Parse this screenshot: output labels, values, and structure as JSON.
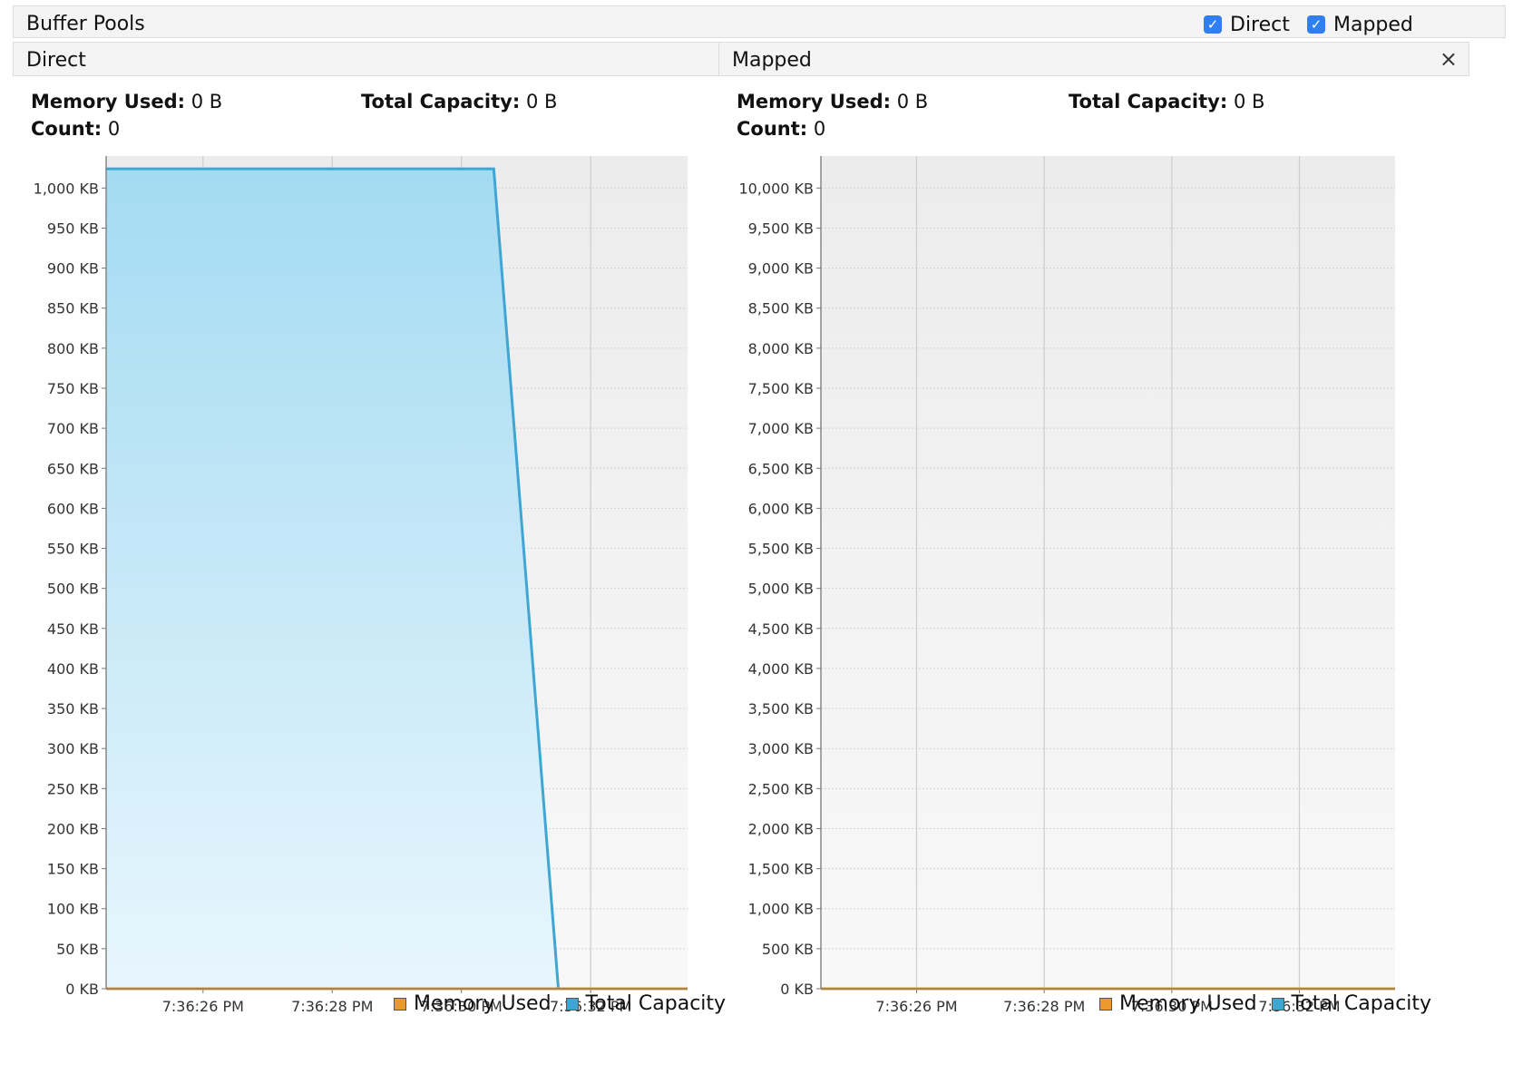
{
  "window": {
    "title": "Buffer Pools",
    "checkboxes": [
      {
        "label": "Direct",
        "checked": true
      },
      {
        "label": "Mapped",
        "checked": true
      }
    ]
  },
  "colors": {
    "memory_used": "#e89a2c",
    "total_capacity": "#3fa6d4",
    "checkbox_accent": "#2f7ff0"
  },
  "panels": [
    {
      "title": "Direct",
      "close_icon": "close-icon",
      "stats": {
        "memory_used_label": "Memory Used:",
        "memory_used_value": "0 B",
        "total_capacity_label": "Total Capacity:",
        "total_capacity_value": "0 B",
        "count_label": "Count:",
        "count_value": "0"
      },
      "legend": [
        "Memory Used",
        "Total Capacity"
      ]
    },
    {
      "title": "Mapped",
      "close_icon": "close-icon",
      "stats": {
        "memory_used_label": "Memory Used:",
        "memory_used_value": "0 B",
        "total_capacity_label": "Total Capacity:",
        "total_capacity_value": "0 B",
        "count_label": "Count:",
        "count_value": "0"
      },
      "legend": [
        "Memory Used",
        "Total Capacity"
      ]
    }
  ],
  "chart_data": [
    {
      "type": "area",
      "panel": "Direct",
      "x_ticks": [
        "7:36:26 PM",
        "7:36:28 PM",
        "7:36:30 PM",
        "7:36:32 PM"
      ],
      "x_tick_seconds": [
        26,
        28,
        30,
        32
      ],
      "xlim_seconds": [
        24.5,
        33.5
      ],
      "ylim": [
        0,
        1040
      ],
      "y_unit": "KB",
      "y_ticks": [
        "0 KB",
        "50 KB",
        "100 KB",
        "150 KB",
        "200 KB",
        "250 KB",
        "300 KB",
        "350 KB",
        "400 KB",
        "450 KB",
        "500 KB",
        "550 KB",
        "600 KB",
        "650 KB",
        "700 KB",
        "750 KB",
        "800 KB",
        "850 KB",
        "900 KB",
        "950 KB",
        "1,000 KB"
      ],
      "y_tick_values": [
        0,
        50,
        100,
        150,
        200,
        250,
        300,
        350,
        400,
        450,
        500,
        550,
        600,
        650,
        700,
        750,
        800,
        850,
        900,
        950,
        1000
      ],
      "grid": true,
      "series": [
        {
          "name": "Memory Used",
          "x_seconds": [
            24.5,
            33.5
          ],
          "values": [
            0,
            0
          ]
        },
        {
          "name": "Total Capacity",
          "x_seconds": [
            24.5,
            30.5,
            31.5,
            33.5
          ],
          "values": [
            1024,
            1024,
            0,
            0
          ]
        }
      ]
    },
    {
      "type": "area",
      "panel": "Mapped",
      "x_ticks": [
        "7:36:26 PM",
        "7:36:28 PM",
        "7:36:30 PM",
        "7:36:32 PM"
      ],
      "x_tick_seconds": [
        26,
        28,
        30,
        32
      ],
      "xlim_seconds": [
        24.5,
        33.5
      ],
      "ylim": [
        0,
        10400
      ],
      "y_unit": "KB",
      "y_ticks": [
        "0 KB",
        "500 KB",
        "1,000 KB",
        "1,500 KB",
        "2,000 KB",
        "2,500 KB",
        "3,000 KB",
        "3,500 KB",
        "4,000 KB",
        "4,500 KB",
        "5,000 KB",
        "5,500 KB",
        "6,000 KB",
        "6,500 KB",
        "7,000 KB",
        "7,500 KB",
        "8,000 KB",
        "8,500 KB",
        "9,000 KB",
        "9,500 KB",
        "10,000 KB"
      ],
      "y_tick_values": [
        0,
        500,
        1000,
        1500,
        2000,
        2500,
        3000,
        3500,
        4000,
        4500,
        5000,
        5500,
        6000,
        6500,
        7000,
        7500,
        8000,
        8500,
        9000,
        9500,
        10000
      ],
      "grid": true,
      "series": [
        {
          "name": "Memory Used",
          "x_seconds": [
            24.5,
            33.5
          ],
          "values": [
            0,
            0
          ]
        },
        {
          "name": "Total Capacity",
          "x_seconds": [
            24.5,
            33.5
          ],
          "values": [
            0,
            0
          ]
        }
      ]
    }
  ]
}
